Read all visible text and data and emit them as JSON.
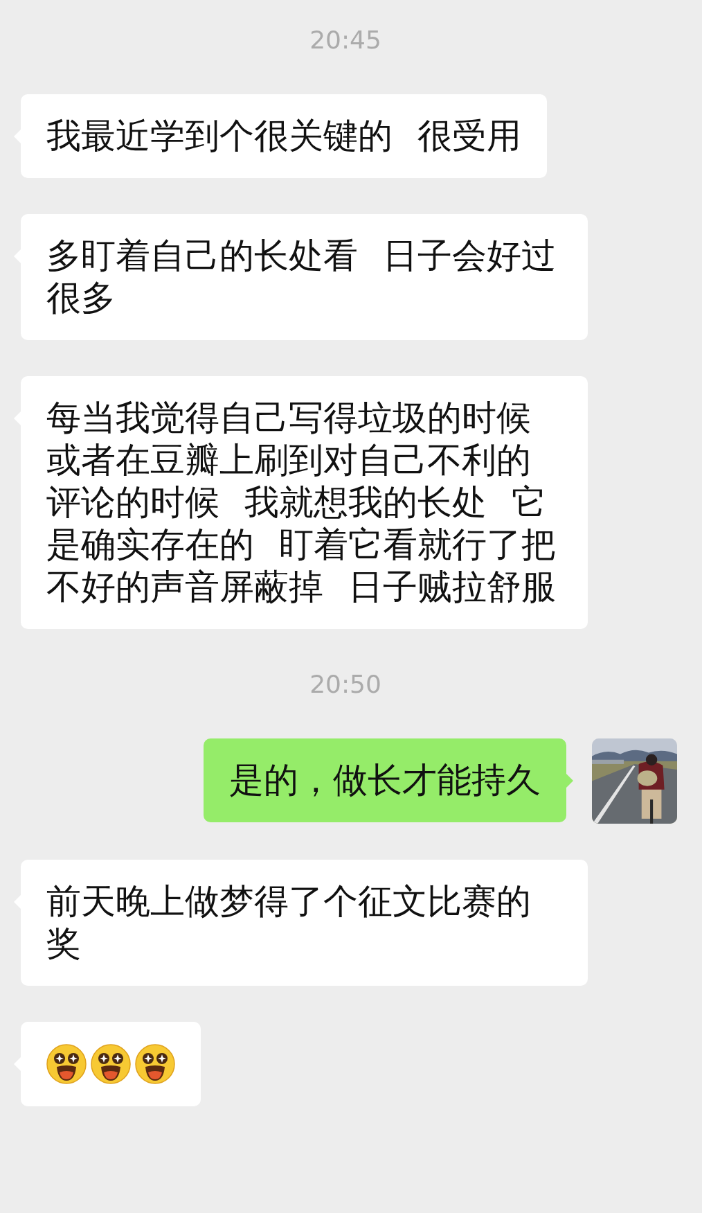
{
  "messages": [
    {
      "kind": "time",
      "text": "20:45"
    },
    {
      "kind": "received",
      "text": "我最近学到个很关键的 很受用"
    },
    {
      "kind": "received",
      "text": "多盯着自己的长处看 日子会好过很多"
    },
    {
      "kind": "received",
      "text": "每当我觉得自己写得垃圾的时候或者在豆瓣上刷到对自己不利的评论的时候 我就想我的长处 它是确实存在的 盯着它看就行了把不好的声音屏蔽掉 日子贼拉舒服"
    },
    {
      "kind": "time",
      "text": "20:50"
    },
    {
      "kind": "sent",
      "text": "是的，做长才能持久"
    },
    {
      "kind": "received",
      "text": "前天晚上做梦得了个征文比赛的奖"
    },
    {
      "kind": "received",
      "stickers": [
        {
          "kind": "star-eyes"
        },
        {
          "kind": "star-eyes"
        },
        {
          "kind": "star-eyes"
        }
      ]
    }
  ]
}
